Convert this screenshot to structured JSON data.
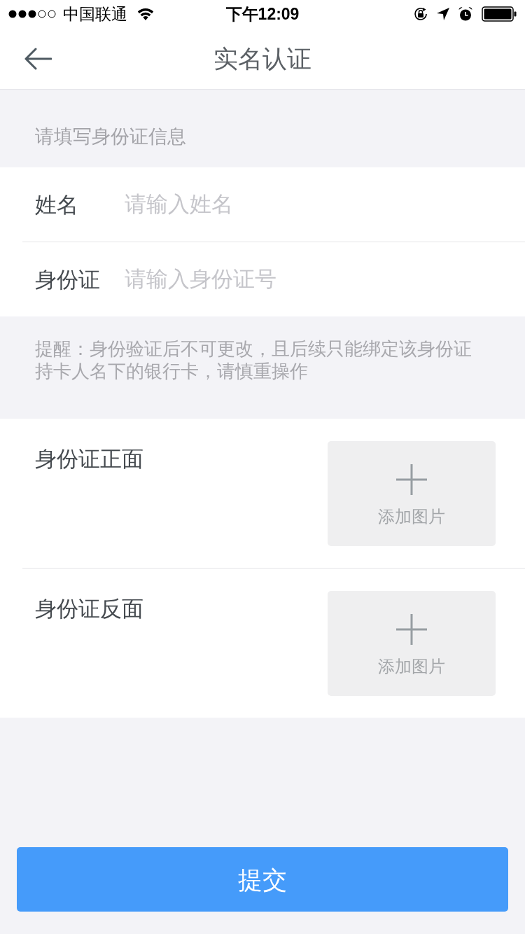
{
  "status_bar": {
    "carrier": "中国联通",
    "time": "下午12:09"
  },
  "nav": {
    "title": "实名认证"
  },
  "section_hint": "请填写身份证信息",
  "fields": [
    {
      "label": "姓名",
      "placeholder": "请输入姓名"
    },
    {
      "label": "身份证",
      "placeholder": "请输入身份证号"
    }
  ],
  "notice": "提醒：身份验证后不可更改，且后续只能绑定该身份证持卡人名下的银行卡，请慎重操作",
  "uploads": [
    {
      "label": "身份证正面",
      "button": "添加图片"
    },
    {
      "label": "身份证反面",
      "button": "添加图片"
    }
  ],
  "submit": "提交"
}
